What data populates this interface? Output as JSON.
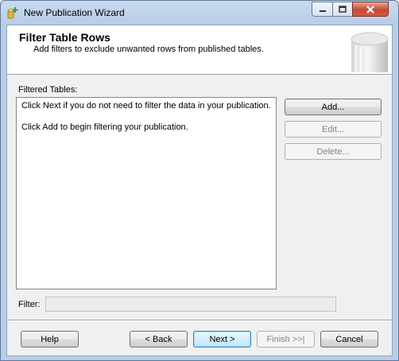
{
  "window": {
    "title": "New Publication Wizard",
    "icon": "publication-wizard-icon"
  },
  "header": {
    "title": "Filter Table Rows",
    "subtitle": "Add filters to exclude unwanted rows from published tables."
  },
  "filtered_tables": {
    "label": "Filtered Tables:",
    "lines": [
      "Click Next if you do not need to filter the data in your publication.",
      "Click Add to begin filtering your publication."
    ]
  },
  "side_buttons": {
    "add": "Add...",
    "edit": "Edit...",
    "delete": "Delete..."
  },
  "filter": {
    "label": "Filter:",
    "value": ""
  },
  "footer": {
    "help": "Help",
    "back": "< Back",
    "next": "Next >",
    "finish": "Finish >>|",
    "cancel": "Cancel"
  }
}
